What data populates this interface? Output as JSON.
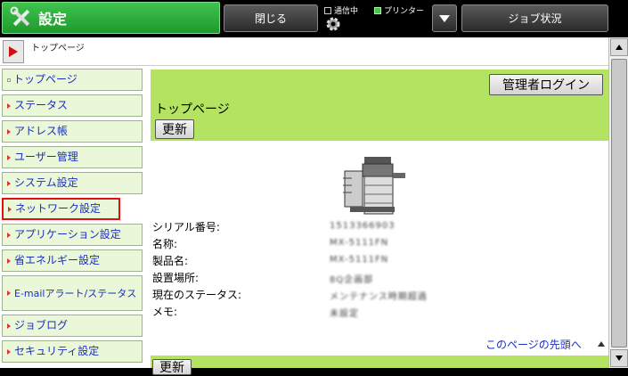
{
  "header": {
    "title": "設定",
    "close_label": "閉じる",
    "job_status_label": "ジョブ状況",
    "status_comm_label": "通信中",
    "status_printer_label": "プリンター"
  },
  "breadcrumb": {
    "text": "トップページ"
  },
  "sidebar": {
    "items": [
      {
        "label": "トップページ"
      },
      {
        "label": "ステータス"
      },
      {
        "label": "アドレス帳"
      },
      {
        "label": "ユーザー管理"
      },
      {
        "label": "システム設定"
      },
      {
        "label": "ネットワーク設定"
      },
      {
        "label": "アプリケーション設定"
      },
      {
        "label": "省エネルギー設定"
      },
      {
        "label": "E-mailアラート/ステータス"
      },
      {
        "label": "ジョブログ"
      },
      {
        "label": "セキュリティ設定"
      }
    ]
  },
  "main": {
    "admin_login_label": "管理者ログイン",
    "page_title": "トップページ",
    "refresh_label": "更新",
    "info": [
      {
        "label": "シリアル番号:",
        "value": "1513366903"
      },
      {
        "label": "名称:",
        "value": "MX-5111FN"
      },
      {
        "label": "製品名:",
        "value": "MX-5111FN"
      },
      {
        "label": "設置場所:",
        "value": "8Q企画部"
      },
      {
        "label": "現在のステータス:",
        "value": "メンテナンス時期超過"
      },
      {
        "label": "メモ:",
        "value": "未設定"
      }
    ],
    "page_top_link": "このページの先頭へ"
  },
  "colors": {
    "title_green": "#2fb03e",
    "panel_green": "#b3e360",
    "nav_bg": "#eaf7d8",
    "link_blue": "#1a2fbf",
    "active_border": "#e01010"
  }
}
